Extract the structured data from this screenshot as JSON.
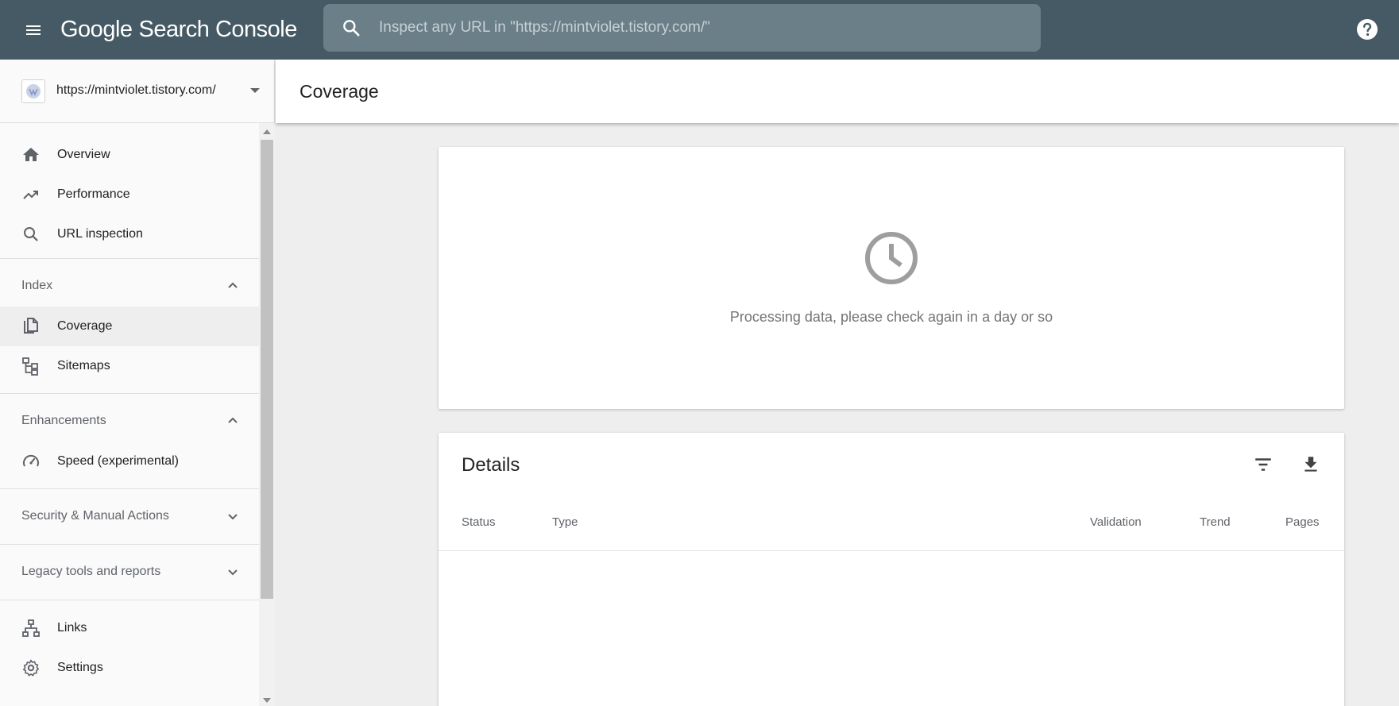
{
  "app": {
    "brand_google": "Google",
    "brand_product": "Search Console"
  },
  "search": {
    "placeholder": "Inspect any URL in \"https://mintviolet.tistory.com/\""
  },
  "property": {
    "label": "https://mintviolet.tistory.com/"
  },
  "sidebar": {
    "top_items": [
      {
        "label": "Overview",
        "icon": "home-icon"
      },
      {
        "label": "Performance",
        "icon": "trending-up-icon"
      },
      {
        "label": "URL inspection",
        "icon": "search-icon"
      }
    ],
    "index": {
      "header": "Index",
      "items": [
        {
          "label": "Coverage",
          "icon": "file-copy-icon",
          "active": true
        },
        {
          "label": "Sitemaps",
          "icon": "sitemap-icon"
        }
      ]
    },
    "enhancements": {
      "header": "Enhancements",
      "items": [
        {
          "label": "Speed (experimental)",
          "icon": "speedometer-icon"
        }
      ]
    },
    "security": {
      "header": "Security & Manual Actions"
    },
    "legacy": {
      "header": "Legacy tools and reports"
    },
    "bottom_items": [
      {
        "label": "Links",
        "icon": "links-icon"
      },
      {
        "label": "Settings",
        "icon": "gear-icon"
      }
    ]
  },
  "page": {
    "title": "Coverage"
  },
  "processing": {
    "message": "Processing data, please check again in a day or so",
    "icon": "clock-icon"
  },
  "details": {
    "title": "Details",
    "columns": [
      "Status",
      "Type",
      "Validation",
      "Trend",
      "Pages"
    ]
  },
  "colors": {
    "topbar": "#455a64",
    "search_bg": "#6b7f89",
    "sidebar_bg": "#fafafa",
    "active_item_bg": "#eeeeee",
    "content_bg": "#eeeeee"
  }
}
